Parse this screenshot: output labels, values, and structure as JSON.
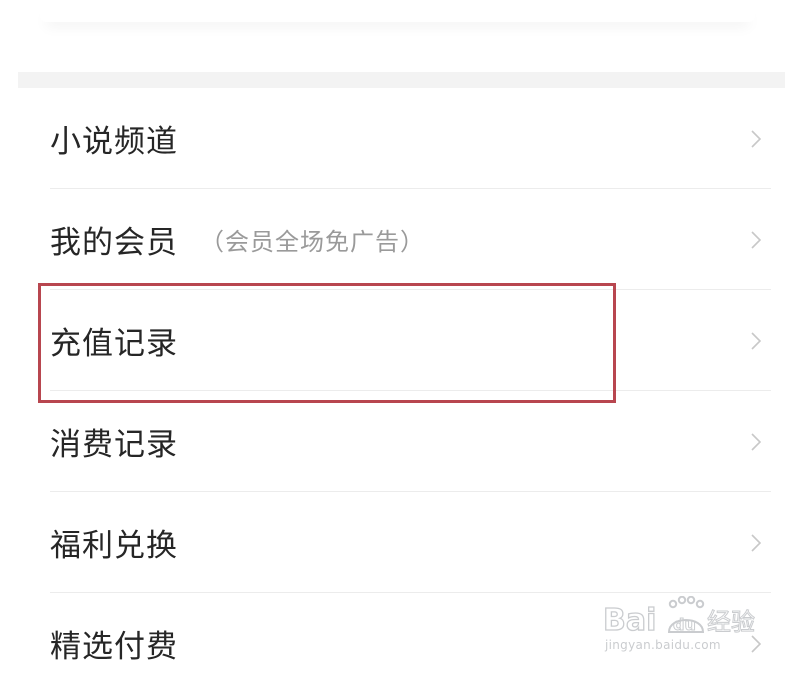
{
  "menu": {
    "items": [
      {
        "label": "小说频道",
        "note": ""
      },
      {
        "label": "我的会员",
        "note": "（会员全场免广告）"
      },
      {
        "label": "充值记录",
        "note": ""
      },
      {
        "label": "消费记录",
        "note": ""
      },
      {
        "label": "福利兑换",
        "note": ""
      },
      {
        "label": "精选付费",
        "note": ""
      }
    ]
  },
  "highlight": {
    "color": "#b8464f",
    "target": "充值记录"
  },
  "icons": {
    "row_arrow": "chevron-right-icon",
    "watermark": "baidu-jingyan-logo"
  },
  "watermark": {
    "logo_text": "Bai du 经验",
    "url": "jingyan.baidu.com"
  }
}
